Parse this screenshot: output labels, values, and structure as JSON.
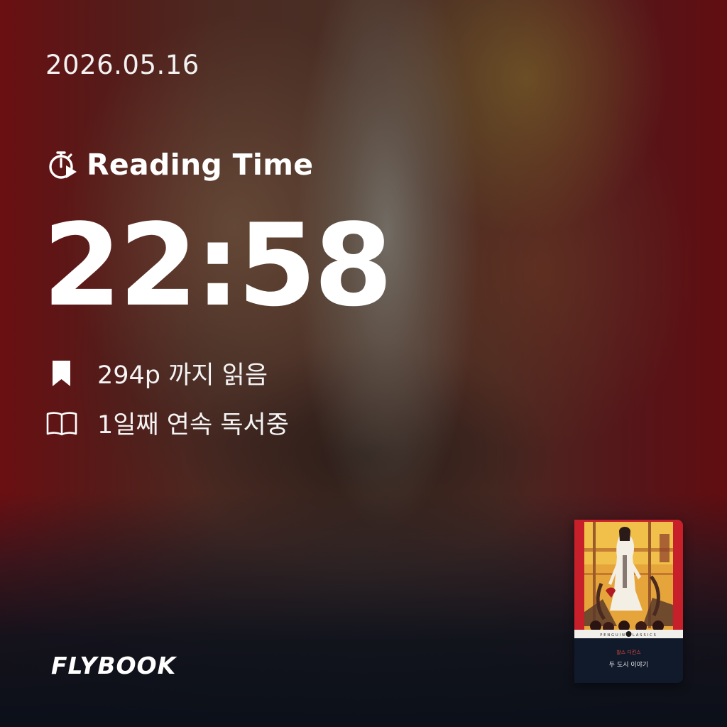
{
  "date": "2026.05.16",
  "reading": {
    "icon": "stopwatch-play-icon",
    "label": "Reading Time",
    "time": "22:58"
  },
  "stats": [
    {
      "icon": "bookmark-icon",
      "text": "294p 까지 읽음"
    },
    {
      "icon": "open-book-icon",
      "text": "1일째 연속 독서중"
    }
  ],
  "brand": "FLYBOOK",
  "book": {
    "series": "PENGUIN CLASSICS",
    "author": "찰스 디킨스",
    "title": "두 도시 이야기"
  },
  "colors": {
    "text": "#ffffff",
    "cover_red": "#c8202a",
    "cover_navy": "#101a2b"
  }
}
